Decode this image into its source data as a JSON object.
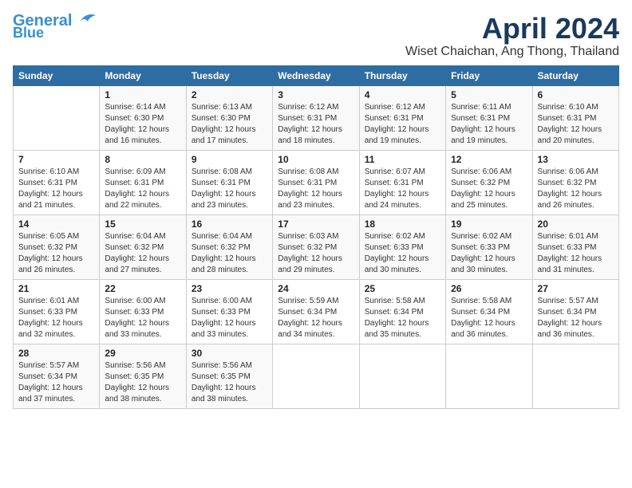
{
  "header": {
    "logo_line1": "General",
    "logo_line2": "Blue",
    "month_title": "April 2024",
    "location": "Wiset Chaichan, Ang Thong, Thailand"
  },
  "calendar": {
    "days_of_week": [
      "Sunday",
      "Monday",
      "Tuesday",
      "Wednesday",
      "Thursday",
      "Friday",
      "Saturday"
    ],
    "weeks": [
      [
        {
          "day": "",
          "info": ""
        },
        {
          "day": "1",
          "info": "Sunrise: 6:14 AM\nSunset: 6:30 PM\nDaylight: 12 hours\nand 16 minutes."
        },
        {
          "day": "2",
          "info": "Sunrise: 6:13 AM\nSunset: 6:30 PM\nDaylight: 12 hours\nand 17 minutes."
        },
        {
          "day": "3",
          "info": "Sunrise: 6:12 AM\nSunset: 6:31 PM\nDaylight: 12 hours\nand 18 minutes."
        },
        {
          "day": "4",
          "info": "Sunrise: 6:12 AM\nSunset: 6:31 PM\nDaylight: 12 hours\nand 19 minutes."
        },
        {
          "day": "5",
          "info": "Sunrise: 6:11 AM\nSunset: 6:31 PM\nDaylight: 12 hours\nand 19 minutes."
        },
        {
          "day": "6",
          "info": "Sunrise: 6:10 AM\nSunset: 6:31 PM\nDaylight: 12 hours\nand 20 minutes."
        }
      ],
      [
        {
          "day": "7",
          "info": "Sunrise: 6:10 AM\nSunset: 6:31 PM\nDaylight: 12 hours\nand 21 minutes."
        },
        {
          "day": "8",
          "info": "Sunrise: 6:09 AM\nSunset: 6:31 PM\nDaylight: 12 hours\nand 22 minutes."
        },
        {
          "day": "9",
          "info": "Sunrise: 6:08 AM\nSunset: 6:31 PM\nDaylight: 12 hours\nand 23 minutes."
        },
        {
          "day": "10",
          "info": "Sunrise: 6:08 AM\nSunset: 6:31 PM\nDaylight: 12 hours\nand 23 minutes."
        },
        {
          "day": "11",
          "info": "Sunrise: 6:07 AM\nSunset: 6:31 PM\nDaylight: 12 hours\nand 24 minutes."
        },
        {
          "day": "12",
          "info": "Sunrise: 6:06 AM\nSunset: 6:32 PM\nDaylight: 12 hours\nand 25 minutes."
        },
        {
          "day": "13",
          "info": "Sunrise: 6:06 AM\nSunset: 6:32 PM\nDaylight: 12 hours\nand 26 minutes."
        }
      ],
      [
        {
          "day": "14",
          "info": "Sunrise: 6:05 AM\nSunset: 6:32 PM\nDaylight: 12 hours\nand 26 minutes."
        },
        {
          "day": "15",
          "info": "Sunrise: 6:04 AM\nSunset: 6:32 PM\nDaylight: 12 hours\nand 27 minutes."
        },
        {
          "day": "16",
          "info": "Sunrise: 6:04 AM\nSunset: 6:32 PM\nDaylight: 12 hours\nand 28 minutes."
        },
        {
          "day": "17",
          "info": "Sunrise: 6:03 AM\nSunset: 6:32 PM\nDaylight: 12 hours\nand 29 minutes."
        },
        {
          "day": "18",
          "info": "Sunrise: 6:02 AM\nSunset: 6:33 PM\nDaylight: 12 hours\nand 30 minutes."
        },
        {
          "day": "19",
          "info": "Sunrise: 6:02 AM\nSunset: 6:33 PM\nDaylight: 12 hours\nand 30 minutes."
        },
        {
          "day": "20",
          "info": "Sunrise: 6:01 AM\nSunset: 6:33 PM\nDaylight: 12 hours\nand 31 minutes."
        }
      ],
      [
        {
          "day": "21",
          "info": "Sunrise: 6:01 AM\nSunset: 6:33 PM\nDaylight: 12 hours\nand 32 minutes."
        },
        {
          "day": "22",
          "info": "Sunrise: 6:00 AM\nSunset: 6:33 PM\nDaylight: 12 hours\nand 33 minutes."
        },
        {
          "day": "23",
          "info": "Sunrise: 6:00 AM\nSunset: 6:33 PM\nDaylight: 12 hours\nand 33 minutes."
        },
        {
          "day": "24",
          "info": "Sunrise: 5:59 AM\nSunset: 6:34 PM\nDaylight: 12 hours\nand 34 minutes."
        },
        {
          "day": "25",
          "info": "Sunrise: 5:58 AM\nSunset: 6:34 PM\nDaylight: 12 hours\nand 35 minutes."
        },
        {
          "day": "26",
          "info": "Sunrise: 5:58 AM\nSunset: 6:34 PM\nDaylight: 12 hours\nand 36 minutes."
        },
        {
          "day": "27",
          "info": "Sunrise: 5:57 AM\nSunset: 6:34 PM\nDaylight: 12 hours\nand 36 minutes."
        }
      ],
      [
        {
          "day": "28",
          "info": "Sunrise: 5:57 AM\nSunset: 6:34 PM\nDaylight: 12 hours\nand 37 minutes."
        },
        {
          "day": "29",
          "info": "Sunrise: 5:56 AM\nSunset: 6:35 PM\nDaylight: 12 hours\nand 38 minutes."
        },
        {
          "day": "30",
          "info": "Sunrise: 5:56 AM\nSunset: 6:35 PM\nDaylight: 12 hours\nand 38 minutes."
        },
        {
          "day": "",
          "info": ""
        },
        {
          "day": "",
          "info": ""
        },
        {
          "day": "",
          "info": ""
        },
        {
          "day": "",
          "info": ""
        }
      ]
    ]
  }
}
